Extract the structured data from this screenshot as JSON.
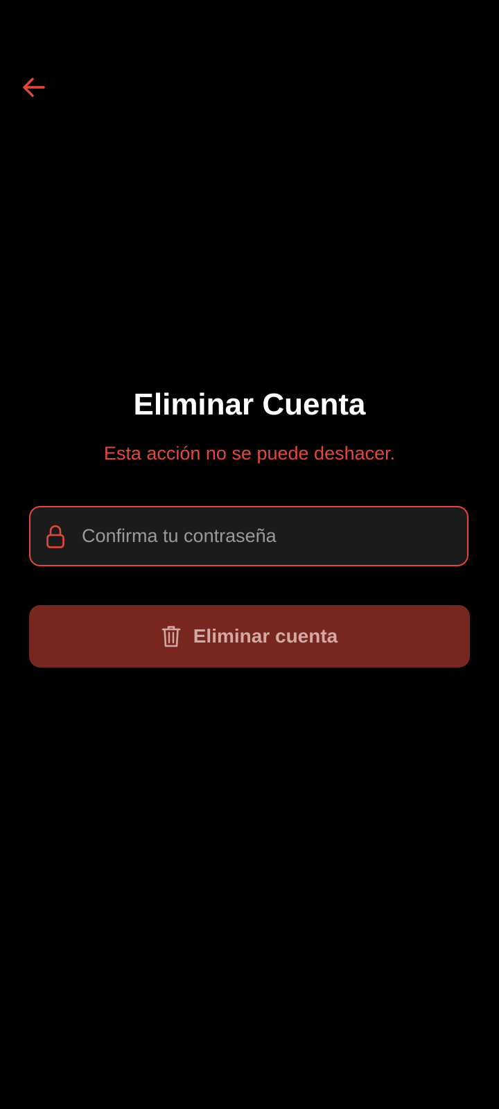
{
  "header": {
    "back_icon": "arrow-left-icon"
  },
  "main": {
    "title": "Eliminar Cuenta",
    "warning": "Esta acción no se puede deshacer.",
    "password_field": {
      "icon": "lock-icon",
      "placeholder": "Confirma tu contraseña",
      "value": ""
    },
    "delete_button": {
      "icon": "trash-icon",
      "label": "Eliminar cuenta"
    }
  },
  "colors": {
    "accent": "#E5473A",
    "background": "#000000",
    "field_background": "#1B1B1B",
    "button_background": "#77271F",
    "button_text": "#D4A8A3"
  }
}
